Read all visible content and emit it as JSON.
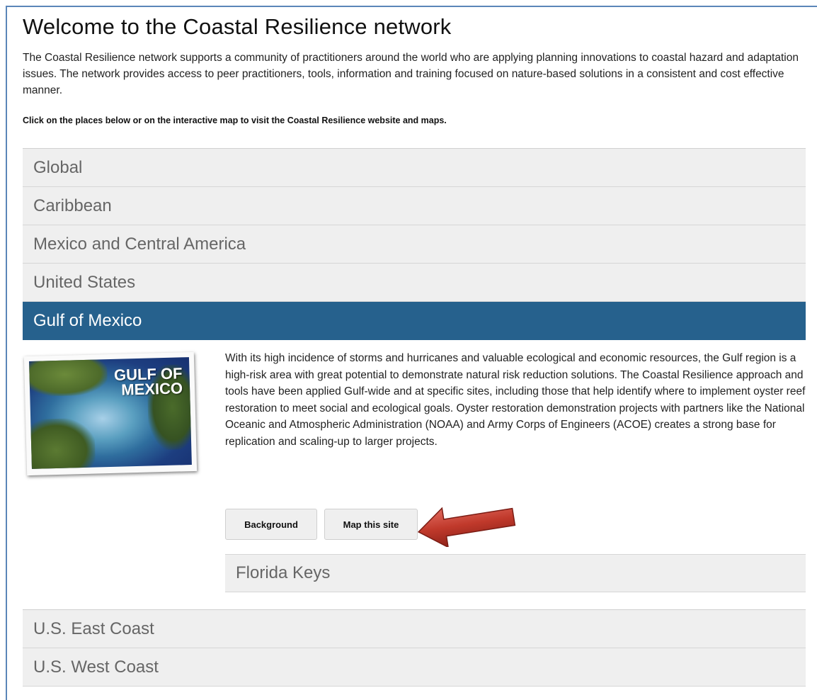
{
  "page": {
    "title": "Welcome to the Coastal Resilience network",
    "intro": "The Coastal Resilience network supports a community of practitioners around the world who are applying planning innovations to coastal hazard and adaptation issues. The network provides access to peer practitioners, tools, information and training focused on nature-based solutions in a consistent and cost effective manner.",
    "instruction": "Click on the places below or on the interactive map to visit the Coastal Resilience website and maps."
  },
  "accordion": {
    "items_before": [
      "Global",
      "Caribbean",
      "Mexico and Central America",
      "United States"
    ],
    "active_label": "Gulf of Mexico",
    "items_after": [
      "U.S. East Coast",
      "U.S. West Coast"
    ]
  },
  "panel": {
    "image_title": "GULF OF\nMEXICO",
    "description": "With its high incidence of storms and hurricanes and valuable ecological and economic resources, the Gulf region is a high-risk area with great potential to demonstrate natural risk reduction solutions. The Coastal Resilience approach and tools have been applied Gulf-wide and at specific sites, including those that help identify where to implement oyster reef restoration to meet social and ecological goals. Oyster restoration demonstration projects with partners like the National Oceanic and Atmospheric Administration (NOAA) and Army Corps of Engineers (ACOE) creates a strong base for replication and scaling-up to larger projects.",
    "background_button": "Background",
    "map_button": "Map this site",
    "sub_item": "Florida Keys"
  },
  "colors": {
    "active": "#26618d",
    "item_bg": "#efefef",
    "arrow": "#c0392b"
  },
  "icons": {
    "arrow": "red-left-arrow-annotation"
  }
}
